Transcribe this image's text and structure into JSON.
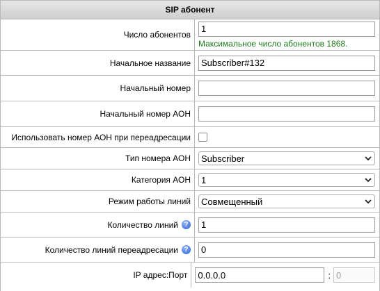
{
  "header": {
    "title": "SIP абонент"
  },
  "fields": {
    "count": {
      "label": "Число абонентов",
      "value": "1",
      "hint": "Максимальное число абонентов 1868."
    },
    "start_name": {
      "label": "Начальное название",
      "value": "Subscriber#132"
    },
    "start_number": {
      "label": "Начальный номер",
      "value": ""
    },
    "start_aon": {
      "label": "Начальный номер АОН",
      "value": ""
    },
    "use_aon_redirect": {
      "label": "Использовать номер АОН при переадресации",
      "checked": false
    },
    "aon_type": {
      "label": "Тип номера АОН",
      "value": "Subscriber"
    },
    "aon_category": {
      "label": "Категория АОН",
      "value": "1"
    },
    "line_mode": {
      "label": "Режим работы линий",
      "value": "Совмещенный"
    },
    "line_count": {
      "label": "Количество линий",
      "value": "1",
      "help_icon": "help-icon"
    },
    "redirect_line_count": {
      "label": "Количество линий переадресации",
      "value": "0",
      "help_icon": "help-icon"
    },
    "ip_port": {
      "label": "IP адрес:Порт",
      "ip": "0.0.0.0",
      "separator": ":",
      "port": "0"
    }
  },
  "colors": {
    "hint": "#1e7b1e",
    "header_bg": "#d9d9d9",
    "border": "#b8b8b8"
  }
}
